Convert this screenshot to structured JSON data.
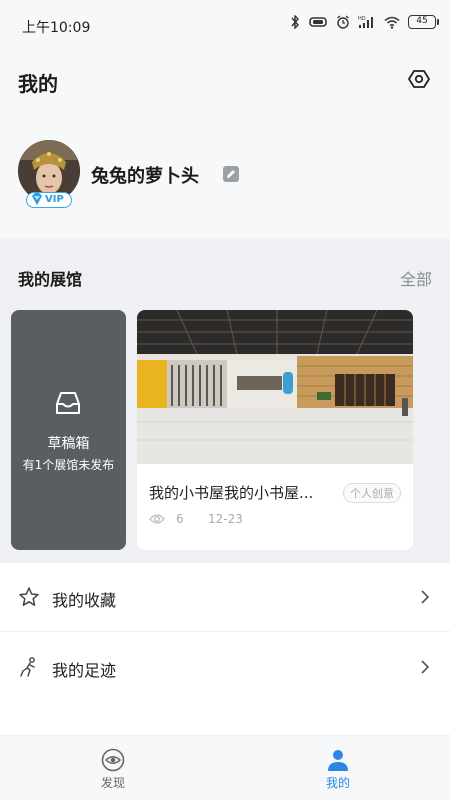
{
  "status_bar": {
    "time": "上午10:09",
    "battery": "45",
    "signal_label": "HD"
  },
  "header": {
    "title": "我的"
  },
  "profile": {
    "username": "兔兔的萝卜头",
    "badge": "VIP"
  },
  "my_halls": {
    "title": "我的展馆",
    "view_all": "全部",
    "draft": {
      "title": "草稿箱",
      "subtitle": "有1个展馆未发布"
    },
    "items": [
      {
        "name": "我的小书屋我的小书屋...",
        "tag": "个人创意",
        "views": "6",
        "date": "12-23"
      }
    ]
  },
  "menu": {
    "favorites": "我的收藏",
    "footprints": "我的足迹"
  },
  "tabbar": {
    "discover": "发现",
    "mine": "我的"
  },
  "colors": {
    "accent": "#2b86e8",
    "vip": "#2b9be0",
    "draft_card": "#5a5e63"
  }
}
